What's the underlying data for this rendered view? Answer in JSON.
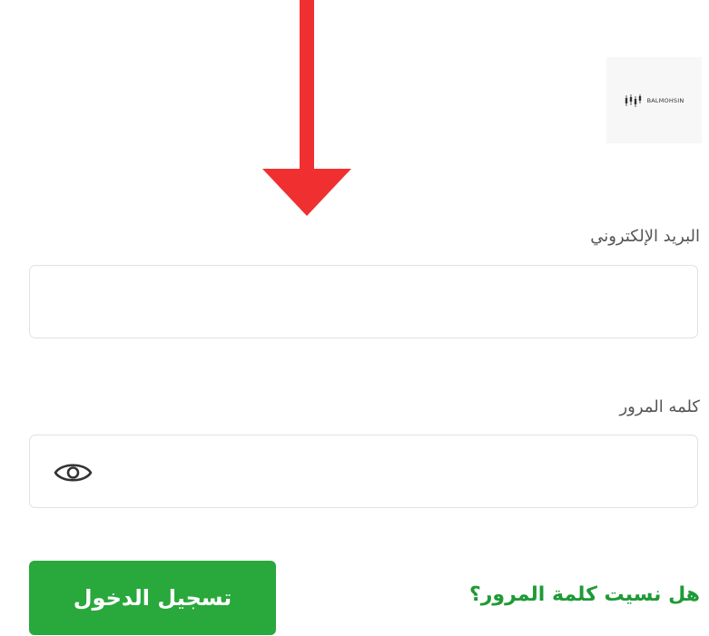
{
  "annotation": {
    "arrow_color": "#f03030"
  },
  "logo": {
    "text": "BALMOHSIN"
  },
  "form": {
    "email_label": "البريد الإلكتروني",
    "email_value": "",
    "password_label": "كلمه المرور",
    "password_value": "",
    "show_password_icon": "eye-icon",
    "login_button_label": "تسجيل الدخول",
    "forgot_password_label": "هل نسيت كلمة المرور؟"
  },
  "colors": {
    "primary_button": "#29a83c",
    "link": "#1f9a36",
    "label": "#555555",
    "field_border": "#e1e1e1"
  }
}
